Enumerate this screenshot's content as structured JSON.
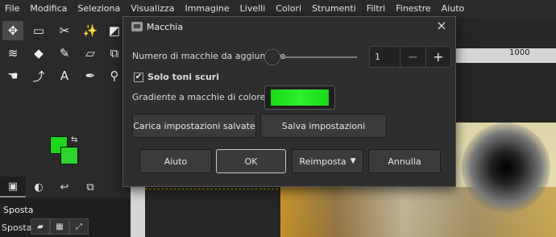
{
  "menubar": {
    "items": [
      "File",
      "Modifica",
      "Seleziona",
      "Visualizza",
      "Immagine",
      "Livelli",
      "Colori",
      "Strumenti",
      "Filtri",
      "Finestre",
      "Aiuto"
    ]
  },
  "toolbox": {
    "tools": [
      {
        "icon": "move-icon",
        "glyph": "✥",
        "active": true
      },
      {
        "icon": "rect-select-icon",
        "glyph": "▭"
      },
      {
        "icon": "scissors-select-icon",
        "glyph": "✂"
      },
      {
        "icon": "fuzzy-select-icon",
        "glyph": "✨"
      },
      {
        "icon": "transform-icon",
        "glyph": "◩"
      },
      {
        "icon": "warp-icon",
        "glyph": "≋"
      },
      {
        "icon": "bucket-fill-icon",
        "glyph": "◆"
      },
      {
        "icon": "paintbrush-icon",
        "glyph": "✎"
      },
      {
        "icon": "eraser-icon",
        "glyph": "▱"
      },
      {
        "icon": "clone-icon",
        "glyph": "⧉"
      },
      {
        "icon": "smudge-icon",
        "glyph": "☚"
      },
      {
        "icon": "path-icon",
        "glyph": "⤴"
      },
      {
        "icon": "text-icon",
        "glyph": "A"
      },
      {
        "icon": "color-picker-icon",
        "glyph": "✒"
      },
      {
        "icon": "zoom-icon",
        "glyph": "⚲"
      }
    ],
    "fg_color": "#1ed61e",
    "bg_color": "#2ed52e"
  },
  "tabs": [
    {
      "icon": "tool-options-icon",
      "glyph": "▣"
    },
    {
      "icon": "device-status-icon",
      "glyph": "◐"
    },
    {
      "icon": "undo-history-icon",
      "glyph": "↩"
    },
    {
      "icon": "images-icon",
      "glyph": "⧉"
    }
  ],
  "panel": {
    "title": "Sposta",
    "label": "Sposta:"
  },
  "ruler": {
    "label": "1000"
  },
  "dialog": {
    "title": "Macchia",
    "count_label": "Numero di macchie da aggiungere",
    "count_value": "1",
    "count_fraction": 0,
    "minus": "−",
    "plus": "+",
    "dark_only_label": "Solo toni scuri",
    "dark_only_checked": true,
    "gradient_label": "Gradiente a macchie di colore",
    "gradient_color": "#18d818",
    "load_label": "Carica impostazioni salvate",
    "save_label": "Salva impostazioni",
    "help_label": "Aiuto",
    "ok_label": "OK",
    "reset_label": "Reimposta",
    "cancel_label": "Annulla"
  }
}
